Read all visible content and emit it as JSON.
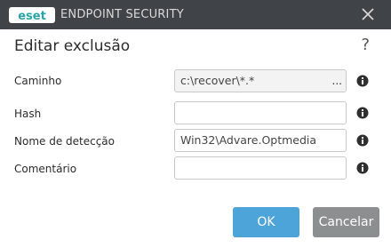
{
  "window": {
    "logo_text": "eset",
    "app_title": "ENDPOINT SECURITY"
  },
  "dialog": {
    "title": "Editar exclusão",
    "help": "?"
  },
  "fields": {
    "path": {
      "label": "Caminho",
      "value": "c:\\recover\\*.*",
      "browse": "..."
    },
    "hash": {
      "label": "Hash",
      "value": ""
    },
    "detection": {
      "label": "Nome de detecção",
      "value": "Win32\\Advare.Optmedia"
    },
    "comment": {
      "label": "Comentário",
      "value": ""
    }
  },
  "buttons": {
    "ok": "OK",
    "cancel": "Cancelar"
  },
  "colors": {
    "titlebar": "#404448",
    "accent": "#4ca4d8",
    "cancel": "#8c8f90",
    "logo_teal": "#2aa3a9"
  }
}
